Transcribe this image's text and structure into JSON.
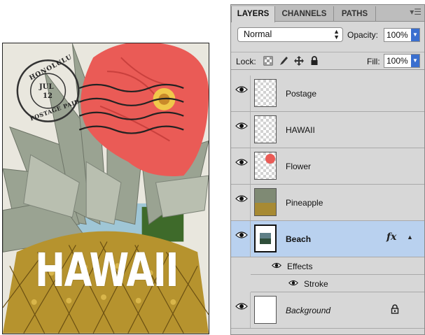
{
  "artwork": {
    "postmark": {
      "city": "HONOLULU",
      "month": "JUL",
      "day": "12",
      "bottom_text": "POSTAGE PAID"
    },
    "title_text": "HAWAII"
  },
  "panel": {
    "tabs": [
      {
        "label": "LAYERS",
        "active": true
      },
      {
        "label": "CHANNELS",
        "active": false
      },
      {
        "label": "PATHS",
        "active": false
      }
    ],
    "menu_icon": "panel-menu-icon",
    "blend_mode": "Normal",
    "opacity_label": "Opacity:",
    "opacity_value": "100%",
    "lock_label": "Lock:",
    "lock_icons": [
      "lock-transparent-icon",
      "lock-image-icon",
      "lock-position-icon",
      "lock-all-icon"
    ],
    "fill_label": "Fill:",
    "fill_value": "100%",
    "layers": [
      {
        "name": "Postage",
        "visible": true,
        "selected": false
      },
      {
        "name": "HAWAII",
        "visible": true,
        "selected": false
      },
      {
        "name": "Flower",
        "visible": true,
        "selected": false
      },
      {
        "name": "Pineapple",
        "visible": true,
        "selected": false
      },
      {
        "name": "Beach",
        "visible": true,
        "selected": true,
        "fx": "fx"
      },
      {
        "name": "Background",
        "visible": true,
        "selected": false,
        "locked": true
      }
    ],
    "effects_label": "Effects",
    "stroke_label": "Stroke"
  },
  "colors": {
    "selection": "#b9d1ef",
    "panel_bg": "#d7d7d7",
    "flower": "#ea5b56",
    "accent_blue": "#3a6fcf"
  }
}
